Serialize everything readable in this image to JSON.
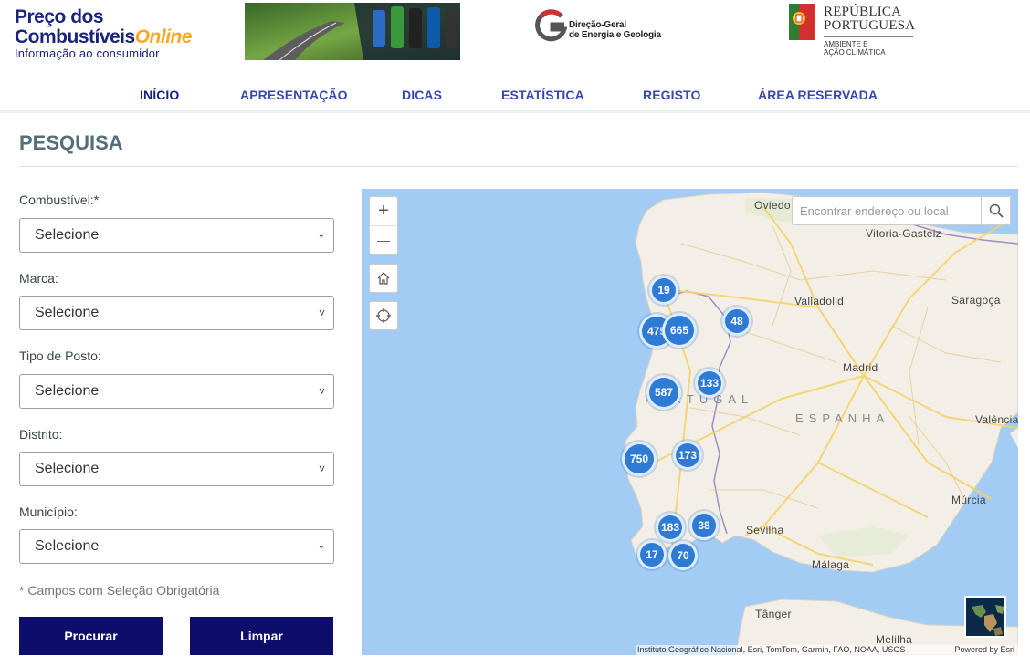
{
  "header": {
    "logo_line1": "Preço dos",
    "logo_line2": "Combustíveis",
    "logo_online": "Online",
    "logo_tagline": "Informação ao consumidor",
    "dgeg_line1": "Direção-Geral",
    "dgeg_line2": "de Energia e Geologia",
    "rep_line1": "REPÚBLICA",
    "rep_line2": "PORTUGUESA",
    "rep_sub1": "AMBIENTE E",
    "rep_sub2": "AÇÃO CLIMÁTICA"
  },
  "nav": {
    "items": [
      {
        "label": "INÍCIO",
        "active": true
      },
      {
        "label": "APRESENTAÇÃO"
      },
      {
        "label": "DICAS"
      },
      {
        "label": "ESTATÍSTICA"
      },
      {
        "label": "REGISTO"
      },
      {
        "label": "ÁREA RESERVADA"
      }
    ]
  },
  "page": {
    "title": "PESQUISA"
  },
  "form": {
    "fields": [
      {
        "label": "Combustível:*",
        "value": "Selecione"
      },
      {
        "label": "Marca:",
        "value": "Selecione"
      },
      {
        "label": "Tipo de Posto:",
        "value": "Selecione"
      },
      {
        "label": "Distrito:",
        "value": "Selecione"
      },
      {
        "label": "Município:",
        "value": "Selecione"
      }
    ],
    "hint": "* Campos com Seleção Obrigatória",
    "search_button": "Procurar",
    "clear_button": "Limpar"
  },
  "map": {
    "search_placeholder": "Encontrar endereço ou local",
    "zoom_in": "+",
    "zoom_out": "—",
    "place_labels": [
      "Oviedo",
      "Vitoria-Gasteiz",
      "Valladolid",
      "Saragoça",
      "Madrid",
      "ESPANHA",
      "PORTUGAL",
      "Valência",
      "Múrcia",
      "Sevilha",
      "Málaga",
      "Tânger",
      "Melilha"
    ],
    "clusters": [
      {
        "count": "19"
      },
      {
        "count": "475"
      },
      {
        "count": "665"
      },
      {
        "count": "48"
      },
      {
        "count": "133"
      },
      {
        "count": "587"
      },
      {
        "count": "750"
      },
      {
        "count": "173"
      },
      {
        "count": "183"
      },
      {
        "count": "38"
      },
      {
        "count": "17"
      },
      {
        "count": "70"
      }
    ],
    "attribution": "Instituto Geográfico Nacional, Esri, TomTom, Garmin, FAO, NOAA, USGS",
    "powered_by": "Powered by Esri"
  },
  "colors": {
    "nav_text": "#3949ab",
    "nav_active": "#1a237e",
    "button_bg": "#0d0d6b",
    "cluster": "#2e7bd6",
    "water": "#a3ccf5",
    "land": "#f3efe6"
  }
}
